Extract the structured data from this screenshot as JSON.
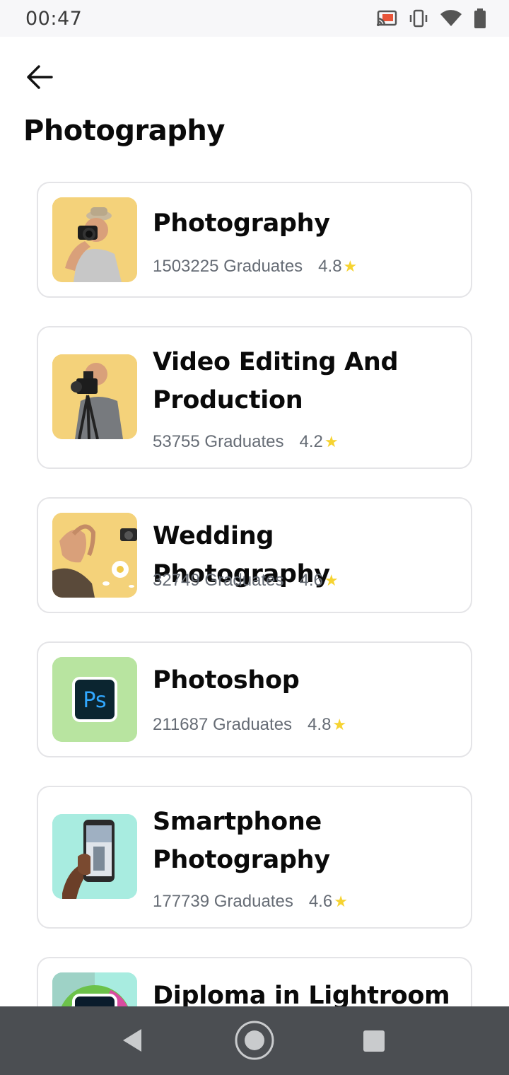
{
  "status_bar": {
    "time": "00:47",
    "icons": [
      "cast-icon",
      "vibrate-icon",
      "wifi-icon",
      "battery-icon"
    ]
  },
  "header": {
    "title": "Photography"
  },
  "courses": [
    {
      "name": "Photography",
      "graduates": "1503225 Graduates",
      "rating": "4.8",
      "thumb_bg": "#f4d27a"
    },
    {
      "name": "Video Editing And Production",
      "graduates": "53755 Graduates",
      "rating": "4.2",
      "thumb_bg": "#f4d27a"
    },
    {
      "name": "Wedding Photography",
      "graduates": "32749 Graduates",
      "rating": "4.6",
      "thumb_bg": "#f4d27a"
    },
    {
      "name": "Photoshop",
      "graduates": "211687 Graduates",
      "rating": "4.8",
      "thumb_bg": "#b8e4a0"
    },
    {
      "name": "Smartphone Photography",
      "graduates": "177739 Graduates",
      "rating": "4.6",
      "thumb_bg": "#a8ece0"
    },
    {
      "name": "Diploma in Lightroom",
      "graduates": "",
      "rating": "",
      "thumb_bg": "#a8ece0"
    }
  ],
  "thumb_labels": {
    "photoshop": "Ps"
  },
  "colors": {
    "star": "#f6d331",
    "nav_bar": "#4b4e52",
    "card_border": "#e4e4e7"
  }
}
